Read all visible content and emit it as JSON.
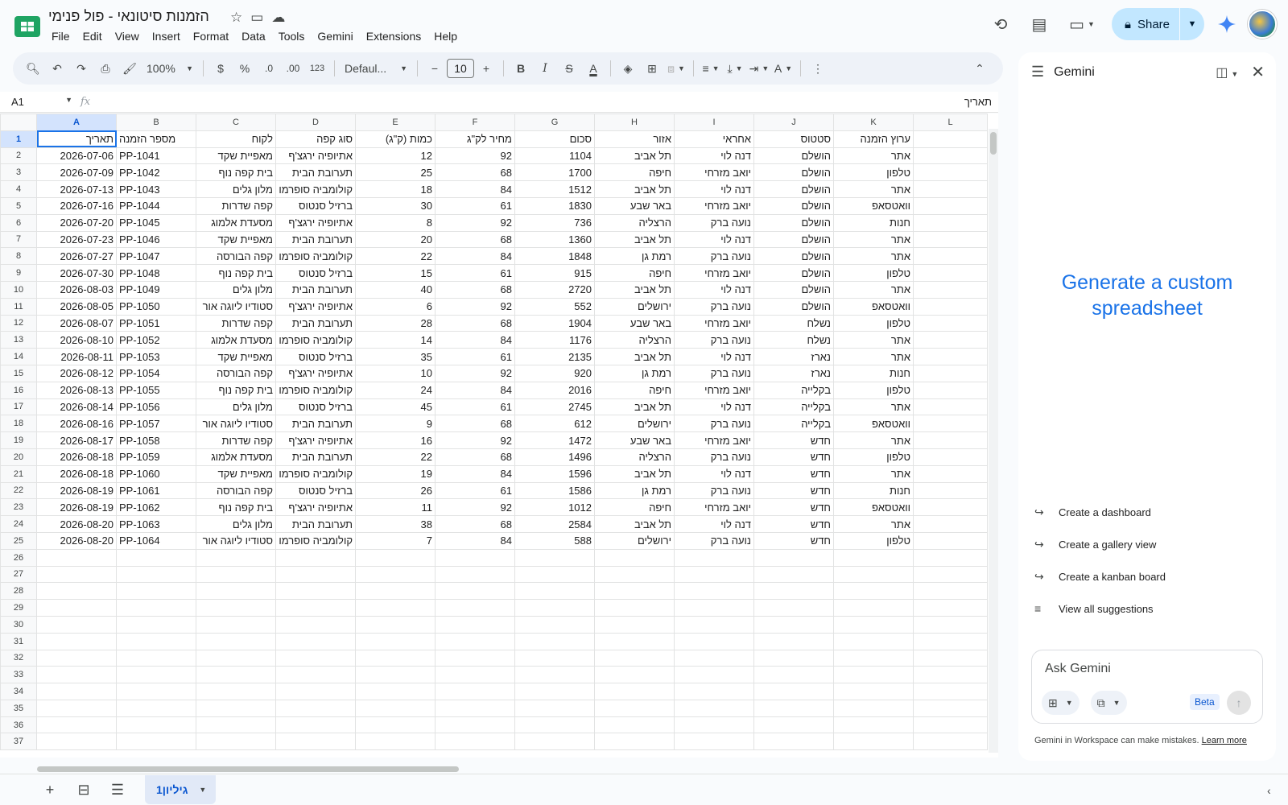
{
  "app": {
    "title": "הזמנות סיטונאי - פול פנימי",
    "menu": [
      "File",
      "Edit",
      "View",
      "Insert",
      "Format",
      "Data",
      "Tools",
      "Gemini",
      "Extensions",
      "Help"
    ],
    "share_label": "Share"
  },
  "toolbar": {
    "zoom": "100%",
    "currency": "$",
    "percent": "%",
    "dec_minus": ".0",
    "dec_plus": ".00",
    "number_format": "123",
    "font": "Defaul...",
    "font_size": "10",
    "bold": "B",
    "italic": "I",
    "strike": "S",
    "text_color": "A"
  },
  "formula_bar": {
    "cell_ref": "A1",
    "fx": "fx",
    "value": "תאריך"
  },
  "sheet": {
    "columns": [
      "A",
      "B",
      "C",
      "D",
      "E",
      "F",
      "G",
      "H",
      "I",
      "J",
      "K",
      "L"
    ],
    "header": [
      "תאריך",
      "מספר הזמנה",
      "לקוח",
      "סוג קפה",
      "כמות (ק\"ג)",
      "מחיר לק\"ג",
      "סכום",
      "אזור",
      "אחראי",
      "סטטוס",
      "ערוץ הזמנה",
      ""
    ],
    "rows": [
      [
        "2026-07-06",
        "PP-1041",
        "מאפיית שקד",
        "אתיופיה ירגצ'ף",
        "12",
        "92",
        "1104",
        "תל אביב",
        "דנה לוי",
        "הושלם",
        "אתר"
      ],
      [
        "2026-07-09",
        "PP-1042",
        "בית קפה נוף",
        "תערובת הבית",
        "25",
        "68",
        "1700",
        "חיפה",
        "יואב מזרחי",
        "הושלם",
        "טלפון"
      ],
      [
        "2026-07-13",
        "PP-1043",
        "מלון גלים",
        "קולומביה סופרמו",
        "18",
        "84",
        "1512",
        "תל אביב",
        "דנה לוי",
        "הושלם",
        "אתר"
      ],
      [
        "2026-07-16",
        "PP-1044",
        "קפה שדרות",
        "ברזיל סנטוס",
        "30",
        "61",
        "1830",
        "באר שבע",
        "יואב מזרחי",
        "הושלם",
        "וואטסאפ"
      ],
      [
        "2026-07-20",
        "PP-1045",
        "מסעדת אלמוג",
        "אתיופיה ירגצ'ף",
        "8",
        "92",
        "736",
        "הרצליה",
        "נועה ברק",
        "הושלם",
        "חנות"
      ],
      [
        "2026-07-23",
        "PP-1046",
        "מאפיית שקד",
        "תערובת הבית",
        "20",
        "68",
        "1360",
        "תל אביב",
        "דנה לוי",
        "הושלם",
        "אתר"
      ],
      [
        "2026-07-27",
        "PP-1047",
        "קפה הבורסה",
        "קולומביה סופרמו",
        "22",
        "84",
        "1848",
        "רמת גן",
        "נועה ברק",
        "הושלם",
        "אתר"
      ],
      [
        "2026-07-30",
        "PP-1048",
        "בית קפה נוף",
        "ברזיל סנטוס",
        "15",
        "61",
        "915",
        "חיפה",
        "יואב מזרחי",
        "הושלם",
        "טלפון"
      ],
      [
        "2026-08-03",
        "PP-1049",
        "מלון גלים",
        "תערובת הבית",
        "40",
        "68",
        "2720",
        "תל אביב",
        "דנה לוי",
        "הושלם",
        "אתר"
      ],
      [
        "2026-08-05",
        "PP-1050",
        "סטודיו ליוגה אור",
        "אתיופיה ירגצ'ף",
        "6",
        "92",
        "552",
        "ירושלים",
        "נועה ברק",
        "הושלם",
        "וואטסאפ"
      ],
      [
        "2026-08-07",
        "PP-1051",
        "קפה שדרות",
        "תערובת הבית",
        "28",
        "68",
        "1904",
        "באר שבע",
        "יואב מזרחי",
        "נשלח",
        "טלפון"
      ],
      [
        "2026-08-10",
        "PP-1052",
        "מסעדת אלמוג",
        "קולומביה סופרמו",
        "14",
        "84",
        "1176",
        "הרצליה",
        "נועה ברק",
        "נשלח",
        "אתר"
      ],
      [
        "2026-08-11",
        "PP-1053",
        "מאפיית שקד",
        "ברזיל סנטוס",
        "35",
        "61",
        "2135",
        "תל אביב",
        "דנה לוי",
        "נארז",
        "אתר"
      ],
      [
        "2026-08-12",
        "PP-1054",
        "קפה הבורסה",
        "אתיופיה ירגצ'ף",
        "10",
        "92",
        "920",
        "רמת גן",
        "נועה ברק",
        "נארז",
        "חנות"
      ],
      [
        "2026-08-13",
        "PP-1055",
        "בית קפה נוף",
        "קולומביה סופרמו",
        "24",
        "84",
        "2016",
        "חיפה",
        "יואב מזרחי",
        "בקלייה",
        "טלפון"
      ],
      [
        "2026-08-14",
        "PP-1056",
        "מלון גלים",
        "ברזיל סנטוס",
        "45",
        "61",
        "2745",
        "תל אביב",
        "דנה לוי",
        "בקלייה",
        "אתר"
      ],
      [
        "2026-08-16",
        "PP-1057",
        "סטודיו ליוגה אור",
        "תערובת הבית",
        "9",
        "68",
        "612",
        "ירושלים",
        "נועה ברק",
        "בקלייה",
        "וואטסאפ"
      ],
      [
        "2026-08-17",
        "PP-1058",
        "קפה שדרות",
        "אתיופיה ירגצ'ף",
        "16",
        "92",
        "1472",
        "באר שבע",
        "יואב מזרחי",
        "חדש",
        "אתר"
      ],
      [
        "2026-08-18",
        "PP-1059",
        "מסעדת אלמוג",
        "תערובת הבית",
        "22",
        "68",
        "1496",
        "הרצליה",
        "נועה ברק",
        "חדש",
        "טלפון"
      ],
      [
        "2026-08-18",
        "PP-1060",
        "מאפיית שקד",
        "קולומביה סופרמו",
        "19",
        "84",
        "1596",
        "תל אביב",
        "דנה לוי",
        "חדש",
        "אתר"
      ],
      [
        "2026-08-19",
        "PP-1061",
        "קפה הבורסה",
        "ברזיל סנטוס",
        "26",
        "61",
        "1586",
        "רמת גן",
        "נועה ברק",
        "חדש",
        "חנות"
      ],
      [
        "2026-08-19",
        "PP-1062",
        "בית קפה נוף",
        "אתיופיה ירגצ'ף",
        "11",
        "92",
        "1012",
        "חיפה",
        "יואב מזרחי",
        "חדש",
        "וואטסאפ"
      ],
      [
        "2026-08-20",
        "PP-1063",
        "מלון גלים",
        "תערובת הבית",
        "38",
        "68",
        "2584",
        "תל אביב",
        "דנה לוי",
        "חדש",
        "אתר"
      ],
      [
        "2026-08-20",
        "PP-1064",
        "סטודיו ליוגה אור",
        "קולומביה סופרמו",
        "7",
        "84",
        "588",
        "ירושלים",
        "נועה ברק",
        "חדש",
        "טלפון"
      ]
    ],
    "empty_rows": [
      26,
      27,
      28,
      29,
      30,
      31,
      32,
      33,
      34,
      35,
      36,
      37
    ],
    "tab_name": "גיליון1"
  },
  "gemini": {
    "title": "Gemini",
    "hero": "Generate a custom spreadsheet",
    "suggestions": [
      "Create a dashboard",
      "Create a gallery view",
      "Create a kanban board",
      "View all suggestions"
    ],
    "input_placeholder": "Ask Gemini",
    "beta": "Beta",
    "footer": "Gemini in Workspace can make mistakes.",
    "learn_more": "Learn more"
  },
  "colors": {
    "accent": "#1a73e8",
    "share_bg": "#c2e7ff",
    "selected_header": "#d3e3fd"
  }
}
